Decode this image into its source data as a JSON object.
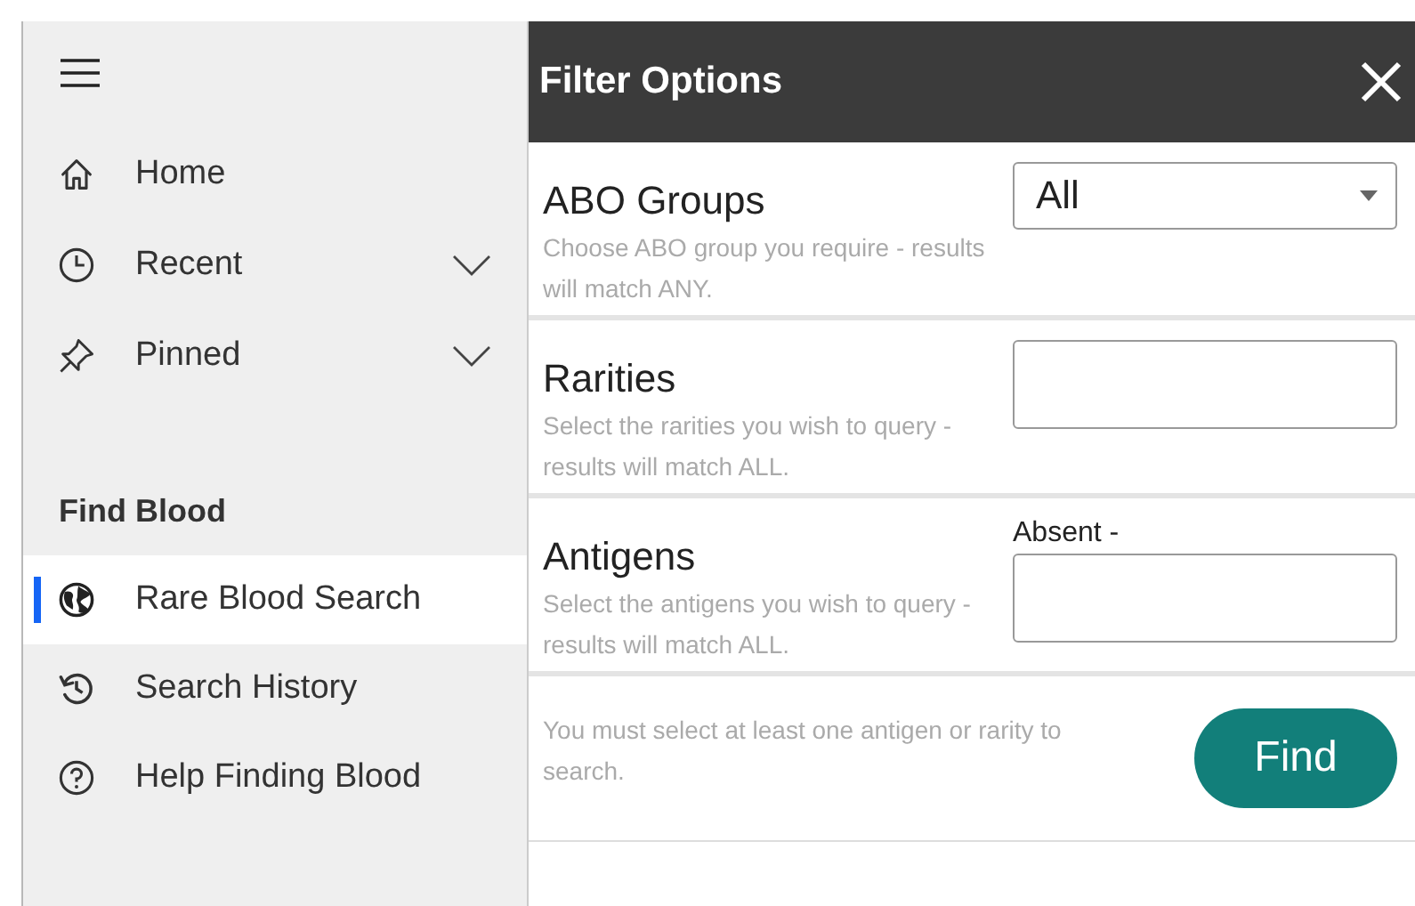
{
  "sidebar": {
    "nav_items": [
      {
        "label": "Home"
      },
      {
        "label": "Recent",
        "expanded": false
      },
      {
        "label": "Pinned",
        "expanded": false
      }
    ],
    "section_title": "Find Blood",
    "section_items": [
      {
        "label": "Rare Blood Search",
        "selected": true
      },
      {
        "label": "Search History",
        "selected": false
      },
      {
        "label": "Help Finding Blood",
        "selected": false
      }
    ]
  },
  "panel": {
    "title": "Filter Options",
    "filters": [
      {
        "kind": "select",
        "label": "ABO Groups",
        "hint": "Choose ABO group you require - results will match ANY.",
        "value": "All"
      },
      {
        "kind": "input",
        "label": "Rarities",
        "hint": "Select the rarities you wish to query - results will match ALL."
      },
      {
        "kind": "input",
        "label": "Antigens",
        "hint": "Select the antigens you wish to query - results will match ALL.",
        "field_label": "Absent -"
      }
    ],
    "footer_note": "You must select at least one antigen or rarity to search.",
    "find_button": "Find"
  }
}
